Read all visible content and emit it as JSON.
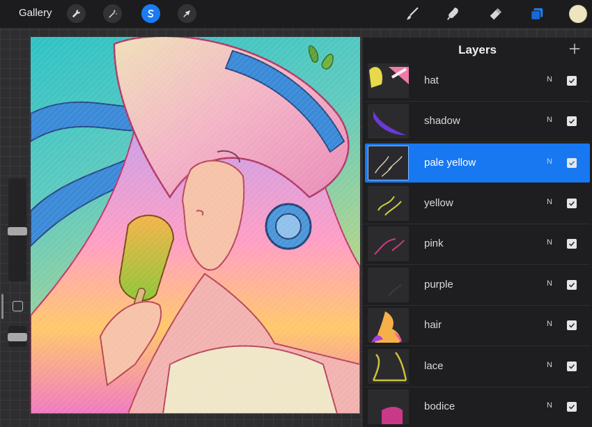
{
  "toolbar": {
    "gallery_label": "Gallery",
    "left_tools": [
      "wrench-icon",
      "magic-wand-icon",
      "selection-s-icon",
      "transform-arrow-icon"
    ],
    "right_tools": [
      "brush-icon",
      "smudge-icon",
      "eraser-icon",
      "layers-icon"
    ],
    "accent_color": "#1a7cf5",
    "current_color": "#ece5c0"
  },
  "layers_panel": {
    "title": "Layers",
    "add_icon": "plus-icon",
    "layers": [
      {
        "name": "hat",
        "blend": "N",
        "visible": true,
        "active": false
      },
      {
        "name": "shadow",
        "blend": "N",
        "visible": true,
        "active": false
      },
      {
        "name": "pale yellow",
        "blend": "N",
        "visible": true,
        "active": true
      },
      {
        "name": "yellow",
        "blend": "N",
        "visible": true,
        "active": false
      },
      {
        "name": "pink",
        "blend": "N",
        "visible": true,
        "active": false
      },
      {
        "name": "purple",
        "blend": "N",
        "visible": true,
        "active": false
      },
      {
        "name": "hair",
        "blend": "N",
        "visible": true,
        "active": false
      },
      {
        "name": "lace",
        "blend": "N",
        "visible": true,
        "active": false
      },
      {
        "name": "bodice",
        "blend": "N",
        "visible": true,
        "active": false
      }
    ]
  },
  "sidebar": {
    "brush_size_icon": "brush-size-slider",
    "opacity_icon": "opacity-slider",
    "modify_icon": "square-icon"
  }
}
